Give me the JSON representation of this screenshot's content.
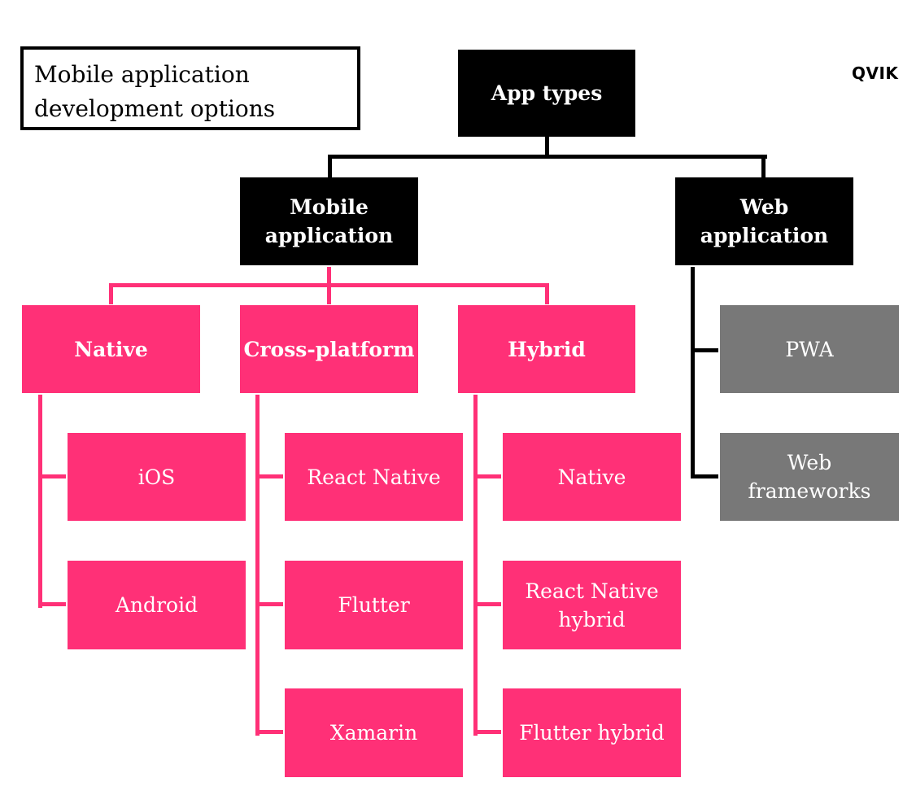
{
  "title": "Mobile application development options",
  "title_lines": [
    "Mobile application",
    "development options"
  ],
  "logo": "QVIK",
  "colors": {
    "level1": "#000000",
    "mobile_branch": "#ff3077",
    "web_leaf": "#787878",
    "text": "#ffffff",
    "background": "#ffffff"
  },
  "tree": {
    "root": {
      "label": "App types"
    },
    "mobile": {
      "lines": [
        "Mobile",
        "application"
      ],
      "categories": [
        {
          "label": "Native",
          "children": [
            "iOS",
            "Android"
          ]
        },
        {
          "label": "Cross-platform",
          "children": [
            "React Native",
            "Flutter",
            "Xamarin"
          ]
        },
        {
          "label": "Hybrid",
          "children": [
            "Native",
            [
              "React Native",
              "hybrid"
            ],
            "Flutter hybrid"
          ]
        }
      ]
    },
    "web": {
      "lines": [
        "Web",
        "application"
      ],
      "children": [
        "PWA",
        [
          "Web",
          "frameworks"
        ]
      ]
    }
  }
}
